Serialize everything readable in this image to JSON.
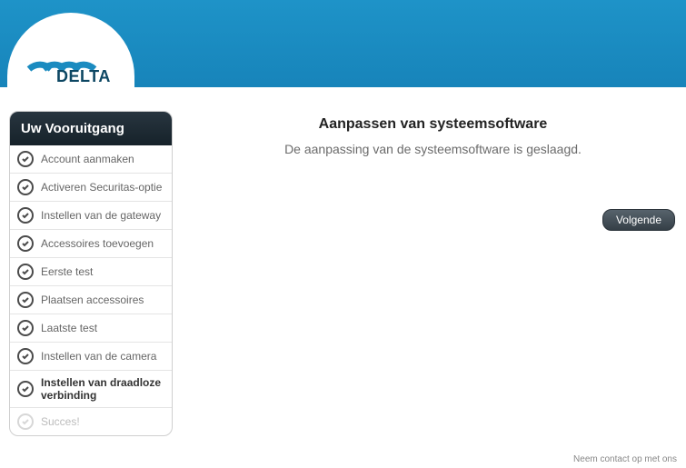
{
  "brand": {
    "name": "DELTA"
  },
  "sidebar": {
    "title": "Uw Vooruitgang",
    "steps": [
      {
        "label": "Account aanmaken",
        "state": "done"
      },
      {
        "label": "Activeren Securitas-optie",
        "state": "done"
      },
      {
        "label": "Instellen van de gateway",
        "state": "done"
      },
      {
        "label": "Accessoires toevoegen",
        "state": "done"
      },
      {
        "label": "Eerste test",
        "state": "done"
      },
      {
        "label": "Plaatsen accessoires",
        "state": "done"
      },
      {
        "label": "Laatste test",
        "state": "done"
      },
      {
        "label": "Instellen van de camera",
        "state": "done"
      },
      {
        "label": "Instellen van draadloze verbinding",
        "state": "current"
      },
      {
        "label": "Succes!",
        "state": "pending"
      }
    ]
  },
  "main": {
    "title": "Aanpassen van systeemsoftware",
    "message": "De aanpassing van de systeemsoftware is geslaagd.",
    "next_label": "Volgende"
  },
  "footer": {
    "contact": "Neem contact op met ons"
  }
}
